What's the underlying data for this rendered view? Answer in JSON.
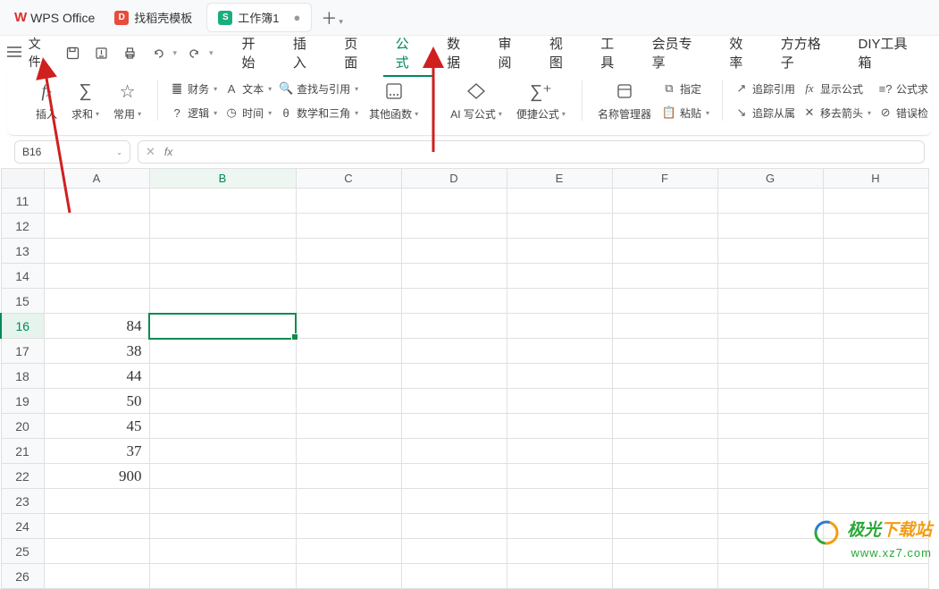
{
  "app": {
    "name": "WPS Office"
  },
  "tabs": [
    {
      "icon_bg": "#e74c3c",
      "icon_text": "D",
      "label": "找稻壳模板"
    },
    {
      "icon_bg": "#1aad7f",
      "icon_text": "S",
      "label": "工作簿1",
      "active": true
    }
  ],
  "file_label": "文件",
  "menu": {
    "items": [
      "开始",
      "插入",
      "页面",
      "公式",
      "数据",
      "审阅",
      "视图",
      "工具",
      "会员专享",
      "效率",
      "方方格子",
      "DIY工具箱"
    ],
    "active_index": 3
  },
  "ribbon": {
    "insert_fx": "插入",
    "sum": "求和",
    "common": "常用",
    "finance": "财务",
    "logic": "逻辑",
    "text": "文本",
    "time": "时间",
    "lookup": "查找与引用",
    "math": "数学和三角",
    "other_fn": "其他函数",
    "ai_formula": "AI 写公式",
    "fast_formula": "便捷公式",
    "name_mgr": "名称管理器",
    "pin": "指定",
    "paste": "粘贴",
    "trace_ref": "追踪引用",
    "trace_dep": "追踪从属",
    "show_formula": "显示公式",
    "remove_arrow": "移去箭头",
    "formula_eval": "公式求",
    "error_check": "错误检"
  },
  "name_box": {
    "value": "B16"
  },
  "columns": [
    "A",
    "B",
    "C",
    "D",
    "E",
    "F",
    "G",
    "H"
  ],
  "rows": [
    {
      "n": 11,
      "A": ""
    },
    {
      "n": 12,
      "A": ""
    },
    {
      "n": 13,
      "A": ""
    },
    {
      "n": 14,
      "A": ""
    },
    {
      "n": 15,
      "A": ""
    },
    {
      "n": 16,
      "A": "84"
    },
    {
      "n": 17,
      "A": "38"
    },
    {
      "n": 18,
      "A": "44"
    },
    {
      "n": 19,
      "A": "50"
    },
    {
      "n": 20,
      "A": "45"
    },
    {
      "n": 21,
      "A": "37"
    },
    {
      "n": 22,
      "A": "900"
    }
  ],
  "selected": {
    "row": 16,
    "col": "B"
  },
  "watermark": {
    "brand": "极光下载站",
    "url": "www.xz7.com"
  }
}
